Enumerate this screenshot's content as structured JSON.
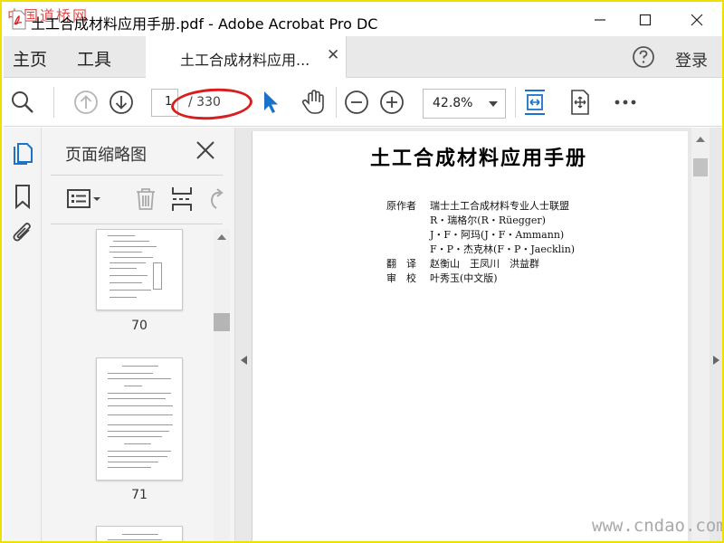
{
  "window": {
    "title": "土工合成材料应用手册.pdf - Adobe Acrobat Pro DC",
    "watermark_top_left": "中国道桥网",
    "watermark_bottom_right": "www.cndao.com"
  },
  "tabbar": {
    "home_label": "主页",
    "tools_label": "工具",
    "document_tab_label": "土工合成材料应用...",
    "login_label": "登录"
  },
  "toolbar": {
    "current_page": "1",
    "total_pages": "/ 330",
    "zoom": "42.8%"
  },
  "thumbnail_panel": {
    "title": "页面缩略图",
    "thumbnails": [
      {
        "label": "70"
      },
      {
        "label": "71"
      }
    ]
  },
  "document": {
    "title": "土工合成材料应用手册",
    "credits": [
      {
        "label": "原作者",
        "value": "瑞士土工合成材料专业人士联盟"
      },
      {
        "label": "",
        "value": "R・瑞格尔(R・Rüegger)"
      },
      {
        "label": "",
        "value": "J・F・阿玛(J・F・Ammann)"
      },
      {
        "label": "",
        "value": "F・P・杰克林(F・P・Jaecklin)"
      },
      {
        "label": "翻　译",
        "value": "赵衡山　王凤川　洪益群"
      },
      {
        "label": "审　校",
        "value": "叶秀玉(中文版)"
      }
    ]
  },
  "colors": {
    "accent_blue": "#1a73c8",
    "annotation_red": "#d81f1f",
    "frame_yellow": "#f0e000"
  }
}
